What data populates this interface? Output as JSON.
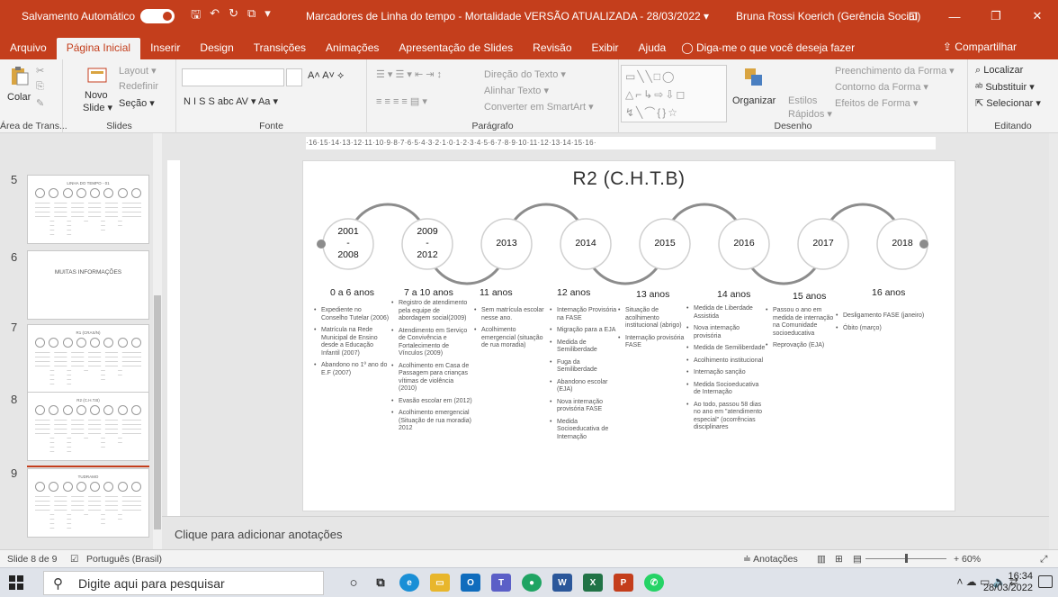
{
  "titlebar": {
    "autosave_label": "Salvamento Automático",
    "autosave_state": "✓ ●",
    "doc_title": "Marcadores de Linha do tempo - Mortalidade VERSÃO ATUALIZADA - 28/03/2022 ▾",
    "user": "Bruna Rossi Koerich (Gerência Social)"
  },
  "menu": {
    "tabs": [
      "Arquivo",
      "Página Inicial",
      "Inserir",
      "Design",
      "Transições",
      "Animações",
      "Apresentação de Slides",
      "Revisão",
      "Exibir",
      "Ajuda"
    ],
    "tellme": "Diga-me o que você deseja fazer",
    "share": "Compartilhar"
  },
  "ribbon": {
    "paste": "Colar",
    "new_slide": "Novo",
    "new_slide2": "Slide ▾",
    "layout": "Layout ▾",
    "reset": "Redefinir",
    "section": "Seção ▾",
    "fmt": "N  I  S  S  abc  AV ▾  Aa ▾",
    "text_direction": "Direção do Texto ▾",
    "align_text": "Alinhar Texto ▾",
    "smartart": "Converter em SmartArt ▾",
    "arrange": "Organizar",
    "styles": "Estilos",
    "quick": "Rápidos ▾",
    "fill": "Preenchimento da Forma ▾",
    "outline": "Contorno da Forma ▾",
    "effects": "Efeitos de Forma ▾",
    "find": "Localizar",
    "replace": "Substituir ▾",
    "select": "Selecionar ▾",
    "groups": {
      "clipboard": "Área de Trans...",
      "slides": "Slides",
      "font": "Fonte",
      "paragraph": "Parágrafo",
      "drawing": "Desenho",
      "editing": "Editando"
    }
  },
  "thumbnails": [
    {
      "num": "5",
      "title": "LINHA DO TEMPO - 01"
    },
    {
      "num": "6",
      "big": "MUITAS INFORMAÇÕES"
    },
    {
      "num": "7",
      "title": "R1 (CRAS/N)"
    },
    {
      "num": "8",
      "title": "R2 (C.H.T.B)"
    },
    {
      "num": "9",
      "title": "TUDRAMO"
    }
  ],
  "ruler": "·16·15·14·13·12·11·10·9·8·7·6·5·4·3·2·1·0·1·2·3·4·5·6·7·8·9·10·11·12·13·14·15·16·",
  "slide": {
    "title": "R2 (C.H.T.B)",
    "years": [
      {
        "a": "2001",
        "b": "-",
        "c": "2008"
      },
      {
        "a": "2009",
        "b": "-",
        "c": "2012"
      },
      {
        "a": "2013"
      },
      {
        "a": "2014"
      },
      {
        "a": "2015"
      },
      {
        "a": "2016"
      },
      {
        "a": "2017"
      },
      {
        "a": "2018"
      }
    ],
    "ages": [
      "0 a 6 anos",
      "7 a 10 anos",
      "11 anos",
      "12 anos",
      "13 anos",
      "14 anos",
      "15 anos",
      "16 anos"
    ],
    "columns": [
      [
        "Expediente no Conselho Tutelar (2006)",
        "Matrícula na Rede Municipal de Ensino desde a Educação Infantil (2007)",
        "Abandono no 1º ano do E.F (2007)"
      ],
      [
        "Registro de atendimento pela equipe de abordagem social(2009)",
        "Atendimento em Serviço de Convivência e Fortalecimento de Vínculos (2009)",
        "Acolhimento em Casa de Passagem para crianças vítimas de violência (2010)",
        "Evasão escolar em (2012)",
        "Acolhimento emergencial (Situação de rua moradia) 2012"
      ],
      [
        "Sem matrícula escolar nesse ano.",
        "Acolhimento emergencial (situação de rua moradia)"
      ],
      [
        "Internação Provisória na FASE",
        "Migração para a EJA",
        "Medida de Semiliberdade",
        "Fuga da Semiliberdade",
        "Abandono escolar (EJA)",
        "Nova internação provisória FASE",
        "Medida Socioeducativa de Internação"
      ],
      [
        "Situação de acolhimento institucional (abrigo)",
        "Internação provisória FASE"
      ],
      [
        "Medida de Liberdade Assistida",
        "Nova internação provisória",
        "Medida de Semiliberdade",
        "Acolhimento institucional",
        "Internação sanção",
        "Medida Socioeducativa de Internação",
        "Ao todo, passou 58 dias no ano em \"atendimento especial\" (ocorrências disciplinares"
      ],
      [
        "Passou o ano em medida de internação na Comunidade socioeducativa",
        "Reprovação (EJA)"
      ],
      [
        "Desligamento FASE (janeiro)",
        "Óbito (março)"
      ]
    ]
  },
  "notes_placeholder": "Clique para adicionar anotações",
  "status": {
    "slide": "Slide 8 de 9",
    "lang": "Português (Brasil)",
    "notes": "≐ Anotações",
    "zoom": "+ 60%"
  },
  "taskbar": {
    "search": "Digite aqui para pesquisar",
    "time": "16:34",
    "date": "28/03/2022"
  },
  "colors": {
    "accent": "#c43e1c",
    "timeline": "#8c8c8c"
  }
}
